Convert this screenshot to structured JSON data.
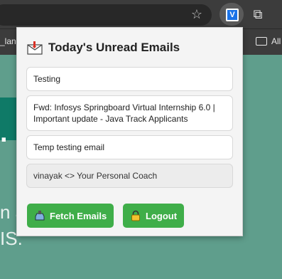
{
  "browser": {
    "bookmark_left": "_lan",
    "bookmark_right": "All"
  },
  "page": {
    "dot": ".",
    "line1": "n a",
    "line2": "IS."
  },
  "popup": {
    "title": "Today's Unread Emails",
    "emails": [
      {
        "subject": "Testing"
      },
      {
        "subject": "Fwd: Infosys Springboard Virtual Internship 6.0 | Important update - Java Track Applicants"
      },
      {
        "subject": "Temp testing email"
      },
      {
        "subject": "vinayak <> Your Personal Coach"
      }
    ],
    "fetch_label": "Fetch Emails",
    "logout_label": "Logout"
  }
}
